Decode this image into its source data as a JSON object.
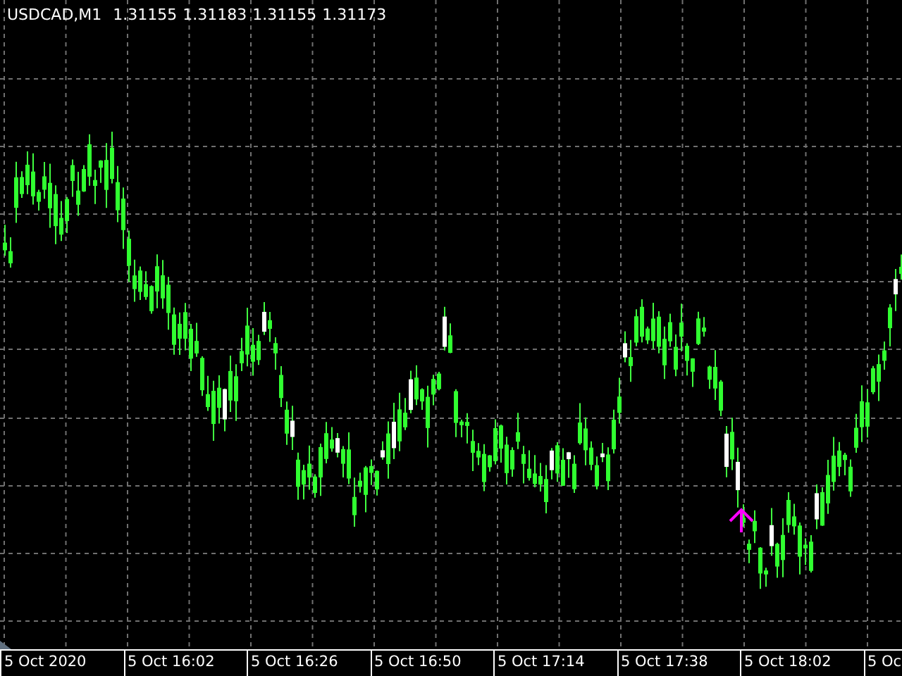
{
  "chart": {
    "symbol": "USDCAD,M1",
    "quotes": [
      "1.31155",
      "1.31183",
      "1.31155",
      "1.31173"
    ],
    "time_labels": [
      "5 Oct 2020",
      "5 Oct 16:02",
      "5 Oct 16:26",
      "5 Oct 16:50",
      "5 Oct 17:14",
      "5 Oct 17:38",
      "5 Oct 18:02",
      "5 Oc"
    ]
  }
}
